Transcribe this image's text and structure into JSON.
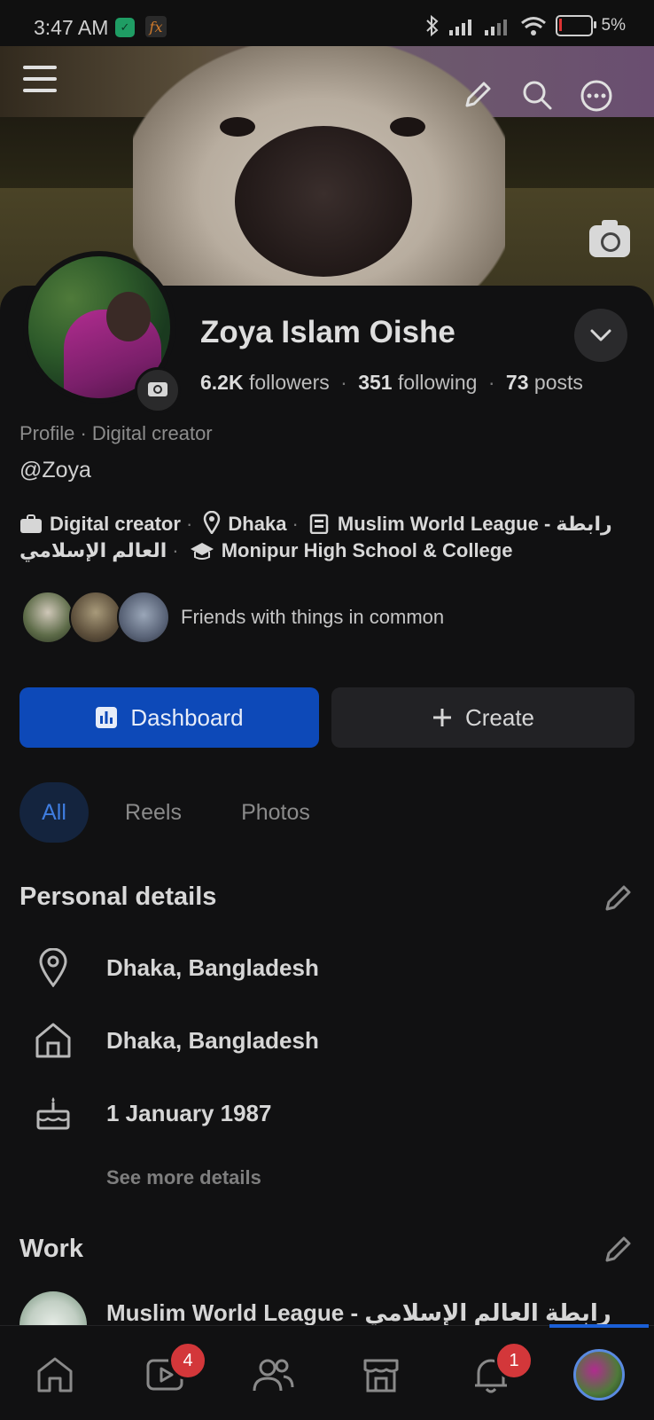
{
  "status_bar": {
    "time": "3:47 AM",
    "battery": "5%"
  },
  "header": {
    "menu_icon": "hamburger-menu-icon",
    "edit_icon": "pencil-icon",
    "search_icon": "search-icon",
    "more_icon": "more-options-icon",
    "cover_camera_icon": "camera-icon"
  },
  "profile": {
    "name": "Zoya Islam Oishe",
    "followers_count": "6.2K",
    "followers_label": "followers",
    "following_count": "351",
    "following_label": "following",
    "posts_count": "73",
    "posts_label": "posts",
    "separator": "·",
    "type": "Profile · Digital creator",
    "handle": "@Zoya"
  },
  "intro": {
    "category": "Digital creator",
    "location": "Dhaka",
    "workplace_line1": "Muslim World League - رابطة",
    "workplace_line2": "العالم الإسلامي",
    "school": "Monipur High School & College"
  },
  "friends": {
    "text": "Friends with things in common"
  },
  "actions": {
    "dashboard_label": "Dashboard",
    "create_label": "Create"
  },
  "tabs": [
    {
      "label": "All",
      "active": true
    },
    {
      "label": "Reels",
      "active": false
    },
    {
      "label": "Photos",
      "active": false
    }
  ],
  "personal_details": {
    "title": "Personal details",
    "current_city": "Dhaka, Bangladesh",
    "hometown": "Dhaka, Bangladesh",
    "birthday": "1 January 1987",
    "see_more": "See more details"
  },
  "work": {
    "title": "Work",
    "employer": "Muslim World League - رابطة العالم الإسلامي"
  },
  "bottom_nav": {
    "items": [
      {
        "name": "home-icon"
      },
      {
        "name": "video-icon",
        "badge": "4"
      },
      {
        "name": "friends-icon"
      },
      {
        "name": "marketplace-icon"
      },
      {
        "name": "notifications-icon",
        "badge": "1"
      },
      {
        "name": "profile-avatar"
      }
    ]
  },
  "colors": {
    "accent": "#0d49b8",
    "badge": "#d3373a",
    "background": "#111112"
  }
}
